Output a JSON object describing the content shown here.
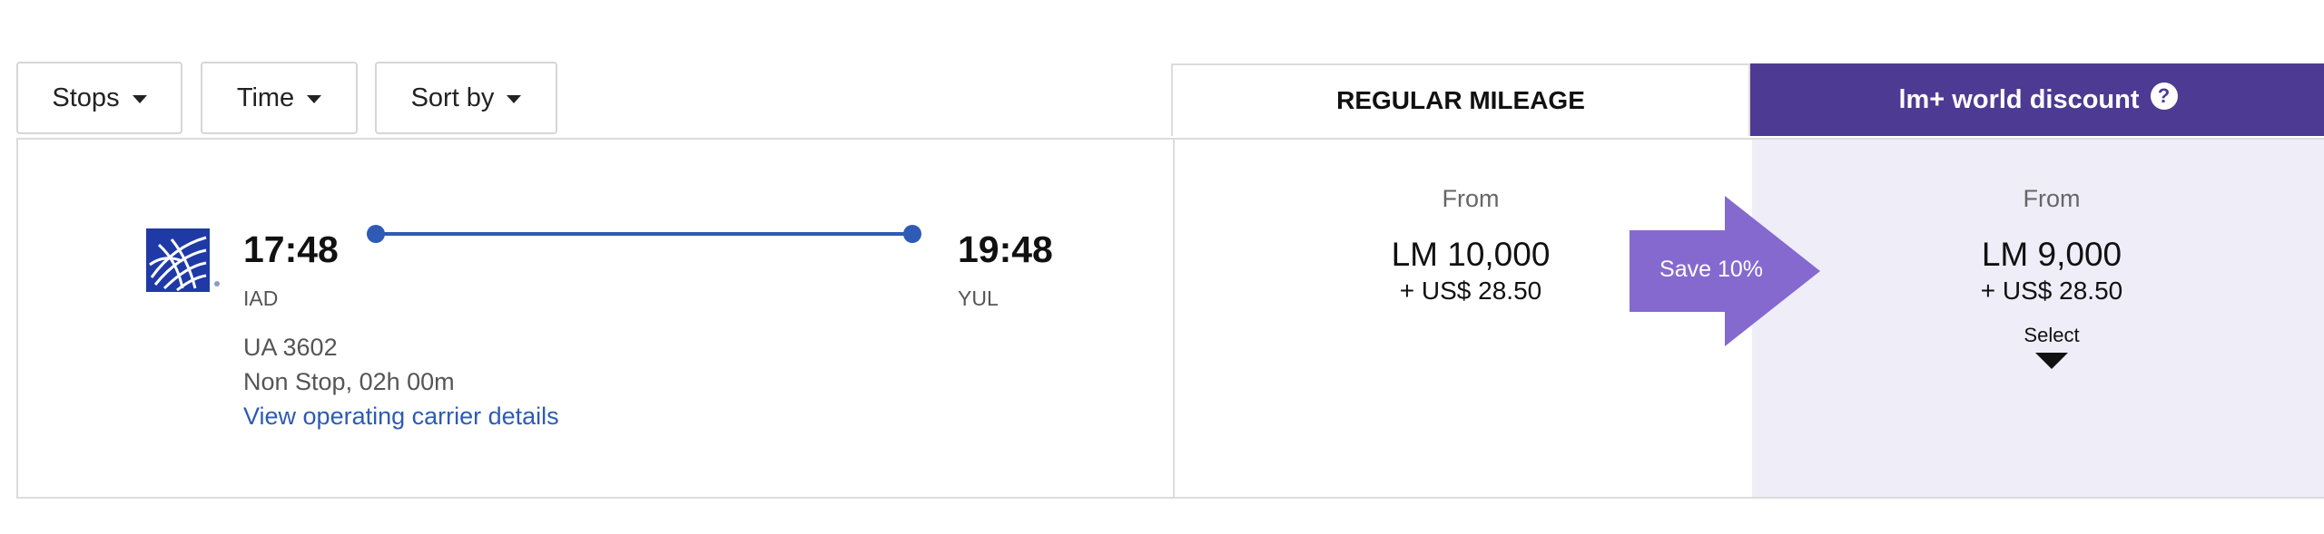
{
  "filters": {
    "stops_label": "Stops",
    "time_label": "Time",
    "sort_label": "Sort by"
  },
  "columns": {
    "regular_label": "REGULAR MILEAGE",
    "discount_label": "lm+ world discount",
    "help_icon_text": "?"
  },
  "flight": {
    "airline_icon": "united-airlines-globe-icon",
    "departure_time": "17:48",
    "departure_airport": "IAD",
    "arrival_time": "19:48",
    "arrival_airport": "YUL",
    "flight_number": "UA 3602",
    "duration": "Non Stop, 02h 00m",
    "carrier_link": "View operating carrier details"
  },
  "regular_fare": {
    "from_label": "From",
    "miles": "LM 10,000",
    "fee": "+ US$ 28.50"
  },
  "discount_fare": {
    "from_label": "From",
    "miles": "LM 9,000",
    "fee": "+ US$ 28.50",
    "select_label": "Select"
  },
  "savings": {
    "label": "Save 10%"
  },
  "colors": {
    "discount_header": "#4d3a93",
    "discount_bg": "#efedf8",
    "save_arrow": "#8569cf",
    "link": "#2d5bb5",
    "route_line": "#2d5bb5"
  }
}
